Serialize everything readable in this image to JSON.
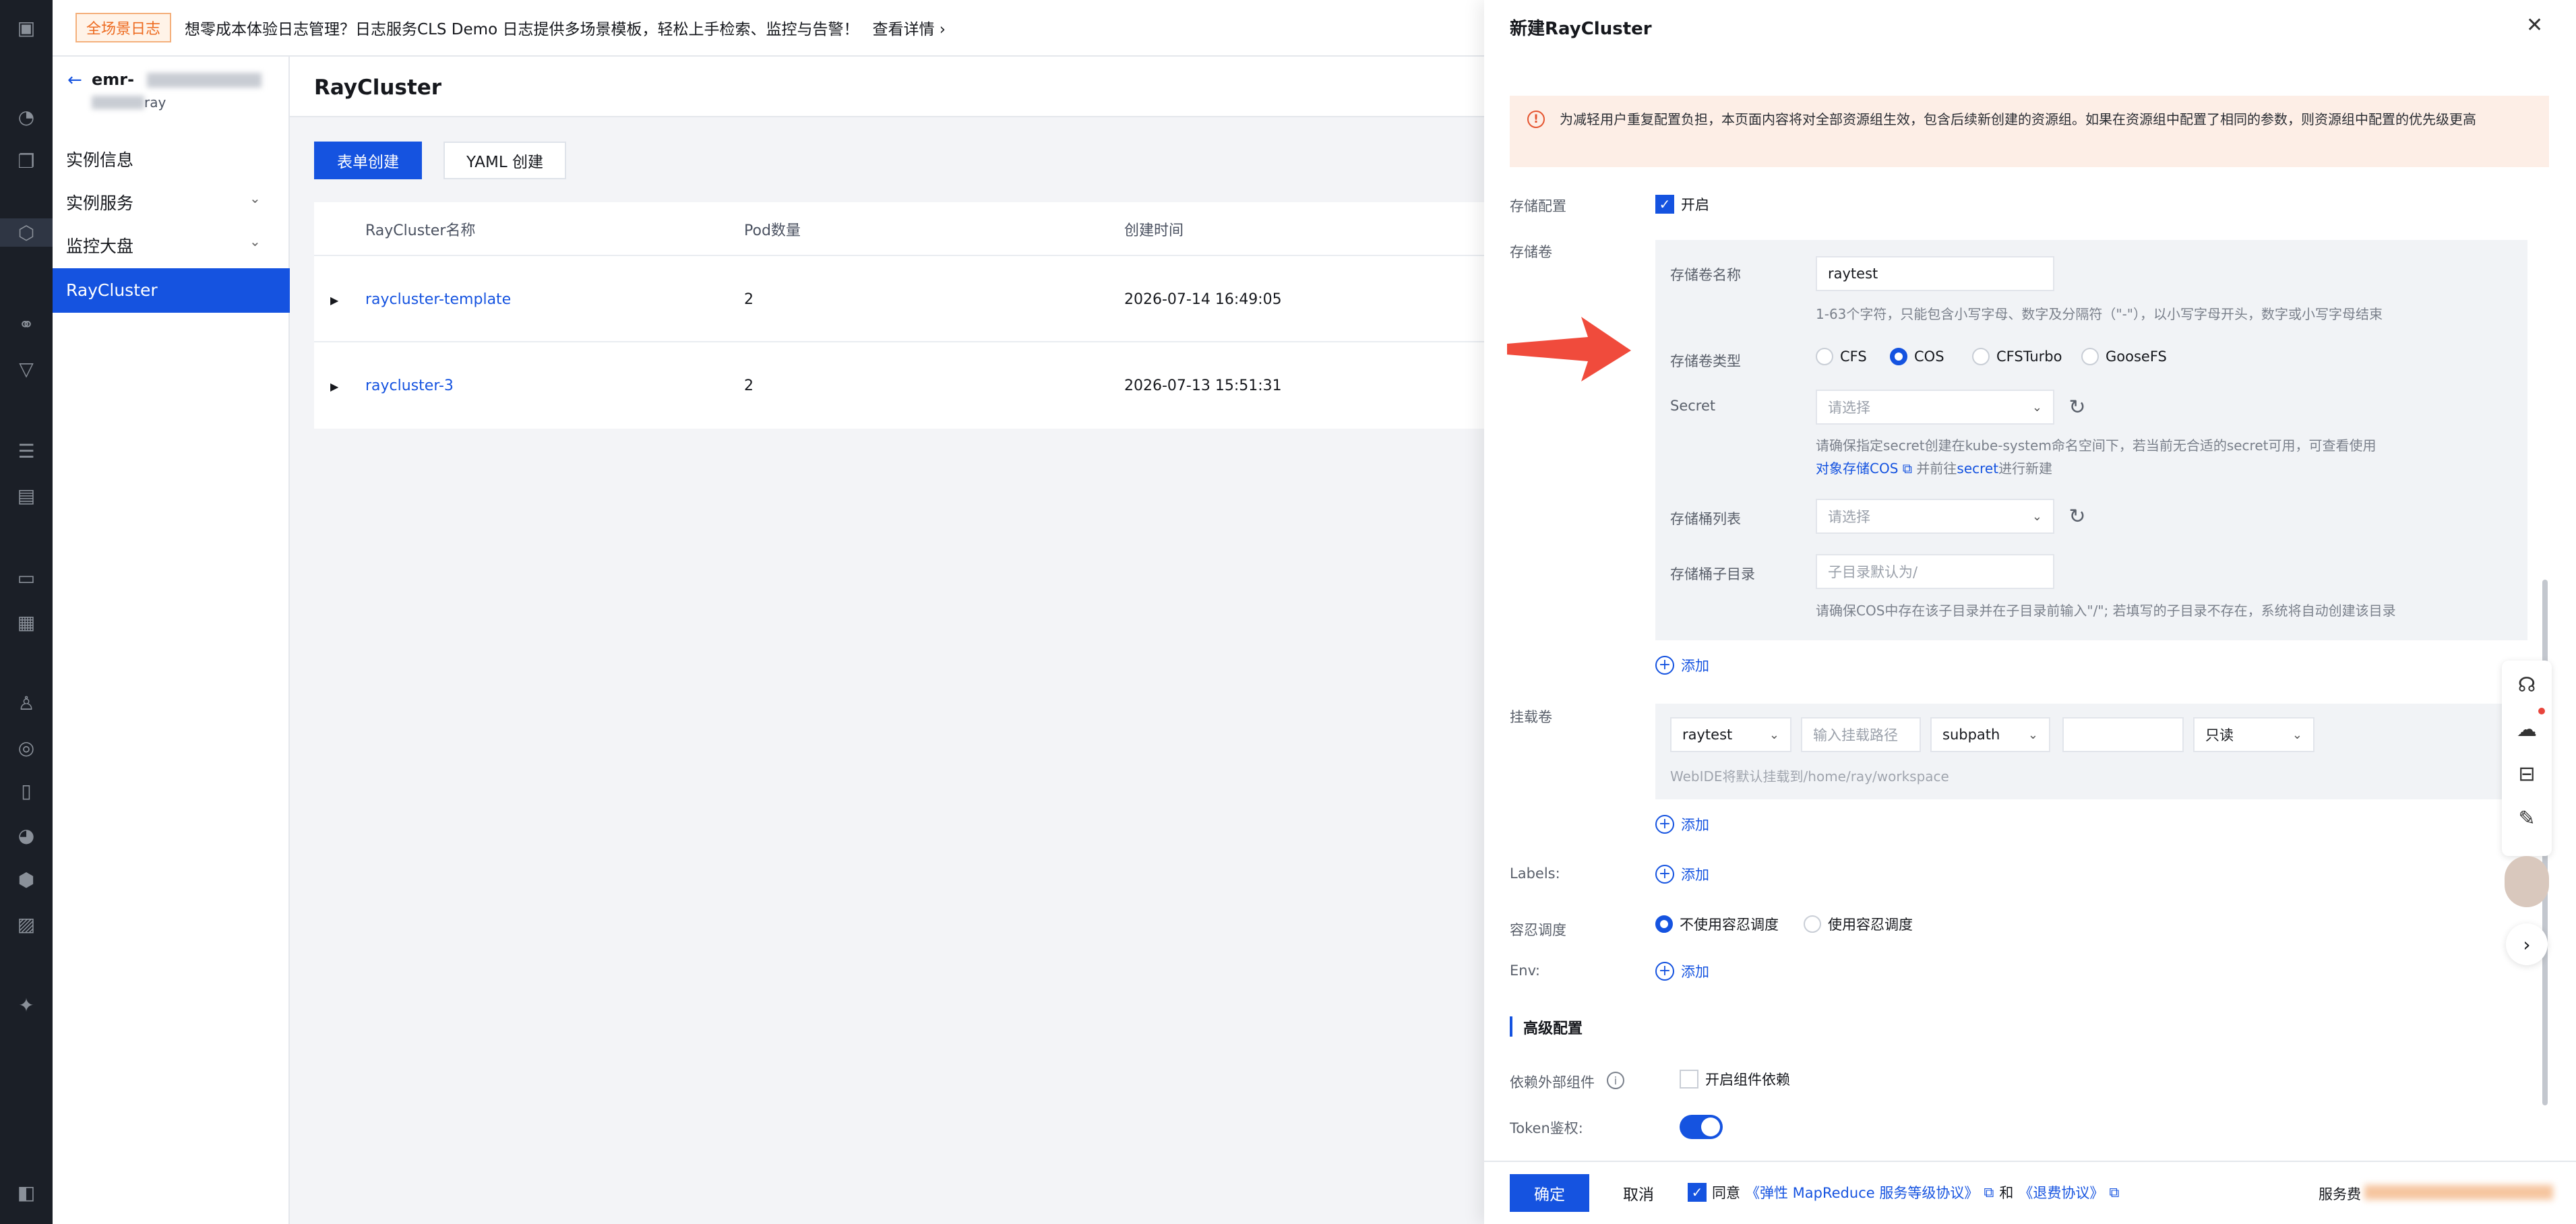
{
  "banner": {
    "tag": "全场景日志",
    "text": "想零成本体验日志管理？日志服务CLS Demo 日志提供多场景模板，轻松上手检索、监控与告警！",
    "link": "查看详情"
  },
  "instance": {
    "name": "emr-",
    "sub": "ray"
  },
  "nav": [
    "实例信息",
    "实例服务",
    "监控大盘",
    "RayCluster"
  ],
  "page_title": "RayCluster",
  "toolbar": {
    "form_create": "表单创建",
    "yaml_create": "YAML 创建"
  },
  "table": {
    "headers": [
      "RayCluster名称",
      "Pod数量",
      "创建时间"
    ],
    "rows": [
      {
        "name": "raycluster-template",
        "pods": "2",
        "created": "2026-07-14 16:49:05"
      },
      {
        "name": "raycluster-3",
        "pods": "2",
        "created": "2026-07-13 15:51:31"
      }
    ]
  },
  "drawer": {
    "title": "新建RayCluster",
    "notice": "为减轻用户重复配置负担，本页面内容将对全部资源组生效，包含后续新创建的资源组。如果在资源组中配置了相同的参数，则资源组中配置的优先级更高",
    "storage_config": {
      "label": "存储配置",
      "checkbox": "开启"
    },
    "storage_label": "存储卷",
    "volume_name": {
      "label": "存储卷名称",
      "value": "raytest",
      "hint": "1-63个字符，只能包含小写字母、数字及分隔符（\"-\"），以小写字母开头，数字或小写字母结束"
    },
    "volume_type": {
      "label": "存储卷类型",
      "options": [
        "CFS",
        "COS",
        "CFSTurbo",
        "GooseFS"
      ],
      "selected": "COS"
    },
    "secret": {
      "label": "Secret",
      "placeholder": "请选择",
      "hint1": "请确保指定secret创建在kube-system命名空间下，若当前无合适的secret可用，可查看使用",
      "hint_link1": "对象存储COS",
      "hint_mid": "并前往",
      "hint_link2": "secret",
      "hint_end": "进行新建"
    },
    "bucket": {
      "label": "存储桶列表",
      "placeholder": "请选择"
    },
    "subdir": {
      "label": "存储桶子目录",
      "placeholder": "子目录默认为/",
      "hint": "请确保COS中存在该子目录并在子目录前输入\"/\"; 若填写的子目录不存在，系统将自动创建该目录"
    },
    "add": "添加",
    "mount": {
      "label": "挂载卷",
      "volume": "raytest",
      "path_placeholder": "输入挂载路径",
      "subpath": "subpath",
      "mode": "只读",
      "hint": "WebIDE将默认挂载到/home/ray/workspace"
    },
    "labels": "Labels:",
    "tolerate": {
      "label": "容忍调度",
      "opt1": "不使用容忍调度",
      "opt2": "使用容忍调度"
    },
    "env": "Env:",
    "advanced": "高级配置",
    "deps": {
      "label": "依赖外部组件",
      "checkbox": "开启组件依赖"
    },
    "token": "Token鉴权:",
    "footer": {
      "ok": "确定",
      "cancel": "取消",
      "agree": "同意",
      "link1": "《弹性 MapReduce 服务等级协议》",
      "and": "和",
      "link2": "《退费协议》",
      "fee": "服务费"
    }
  },
  "colors": {
    "primary": "#1553e0",
    "arrow": "#f04b3c"
  }
}
